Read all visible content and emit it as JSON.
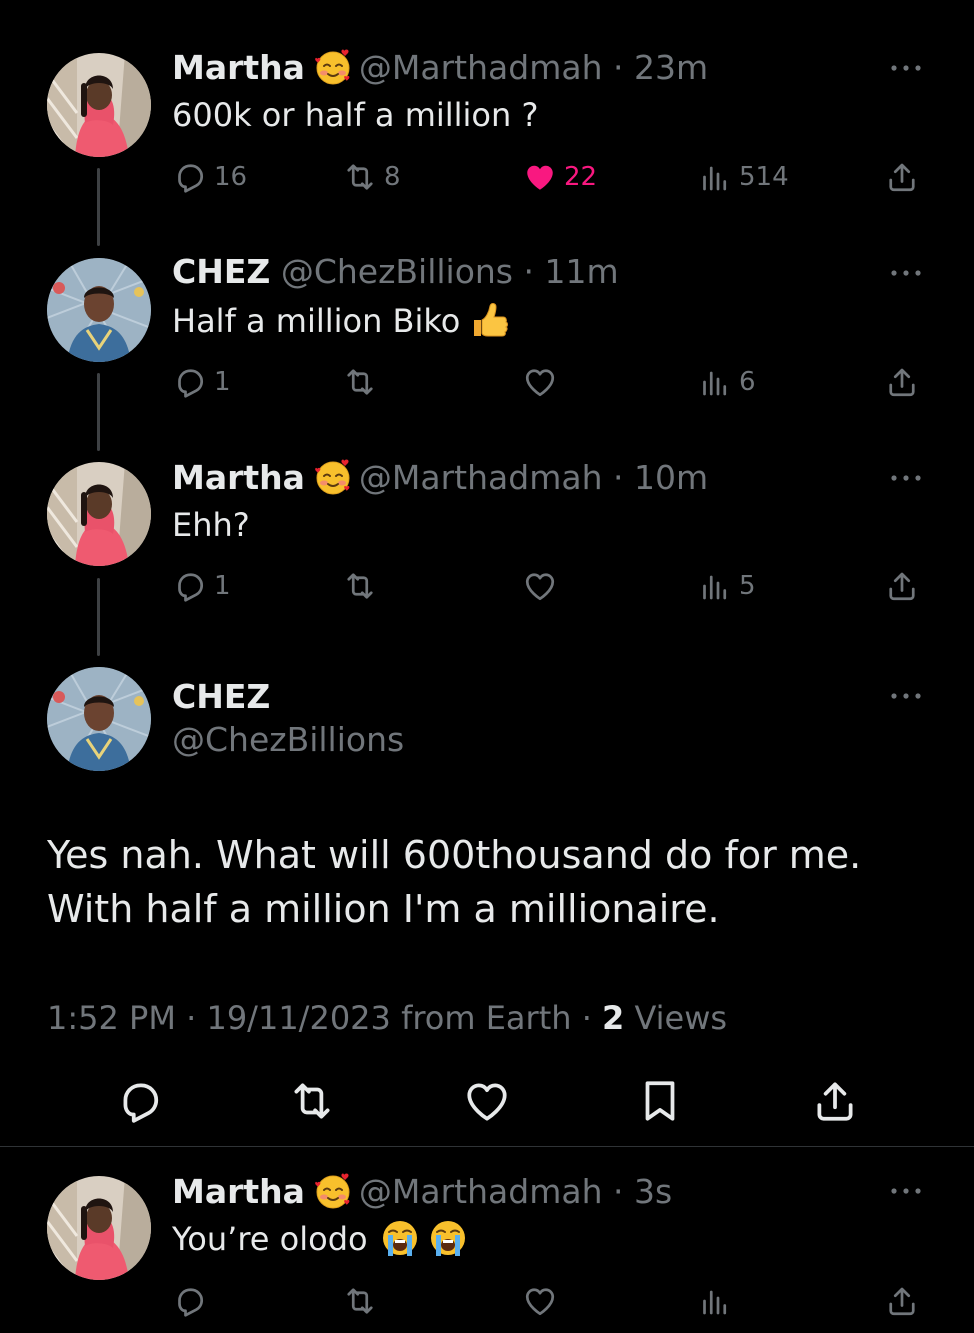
{
  "tweets": [
    {
      "name": "Martha",
      "name_emoji": "smiling-face-with-hearts",
      "handle": "@Marthadmah",
      "time": "23m",
      "text": "600k or half a million ?",
      "replies": "16",
      "retweets": "8",
      "likes": "22",
      "liked": true,
      "views": "514"
    },
    {
      "name": "CHEZ",
      "handle": "@ChezBillions",
      "time": "11m",
      "text": "Half a million Biko",
      "text_emoji": "thumbs-up",
      "replies": "1",
      "retweets": "",
      "likes": "",
      "views": "6"
    },
    {
      "name": "Martha",
      "name_emoji": "smiling-face-with-hearts",
      "handle": "@Marthadmah",
      "time": "10m",
      "text": "Ehh?",
      "replies": "1",
      "retweets": "",
      "likes": "",
      "views": "5"
    }
  ],
  "focused": {
    "name": "CHEZ",
    "handle": "@ChezBillions",
    "text": "Yes nah. What will 600thousand do for me. With half a million I'm a millionaire.",
    "time": "1:52 PM",
    "date": "19/11/2023",
    "source": "from Earth",
    "views_count": "2",
    "views_label": "Views"
  },
  "reply": {
    "name": "Martha",
    "name_emoji": "smiling-face-with-hearts",
    "handle": "@Marthadmah",
    "time": "3s",
    "text": "You’re olodo",
    "text_emojis": [
      "loudly-crying-face",
      "loudly-crying-face"
    ],
    "replies": "",
    "retweets": "",
    "likes": "",
    "views": ""
  },
  "colors": {
    "background": "#000000",
    "text": "#e7e9ea",
    "muted": "#71767b",
    "like": "#f91880",
    "thread_line": "#3e4144"
  }
}
